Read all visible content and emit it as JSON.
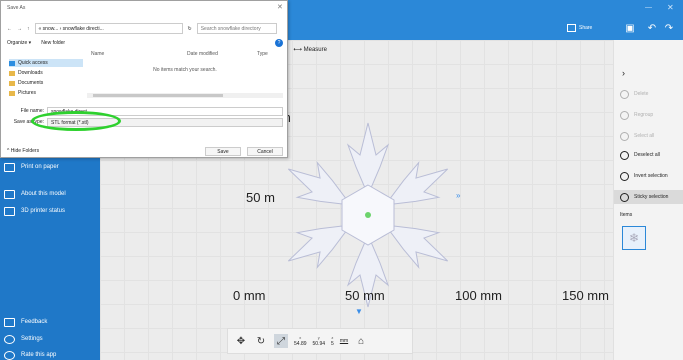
{
  "toolbar": {
    "share_label": "Share",
    "min_glyph": "—",
    "close_glyph": "✕",
    "undo_glyph": "↶",
    "redo_glyph": "↷"
  },
  "sidebar": {
    "items": [
      {
        "label": "Print on paper",
        "icon": "printer-icon"
      },
      {
        "label": "About this model",
        "icon": "info-card-icon"
      },
      {
        "label": "3D printer status",
        "icon": "list-icon"
      }
    ],
    "bottom_items": [
      {
        "label": "Feedback",
        "icon": "feedback-icon"
      },
      {
        "label": "Settings",
        "icon": "gear-icon"
      },
      {
        "label": "Rate this app",
        "icon": "smiley-icon"
      }
    ]
  },
  "viewport": {
    "measure_toolbar": {
      "left_label": "er",
      "measure_label": "Measure"
    },
    "axis_labels": [
      "0 mm",
      "50 mm",
      "100 mm",
      "150 mm"
    ],
    "side_labels": [
      "m",
      "50 m"
    ]
  },
  "bottom_toolbar": {
    "coords": [
      {
        "axis": "x",
        "value": "54.89"
      },
      {
        "axis": "y",
        "value": "50.94"
      },
      {
        "axis": "z",
        "value": "5"
      }
    ],
    "unit": "mm"
  },
  "right_panel": {
    "items": [
      {
        "label": "Delete",
        "disabled": true
      },
      {
        "label": "Regroup",
        "disabled": true
      },
      {
        "label": "Select all",
        "disabled": true
      },
      {
        "label": "Deselect all",
        "disabled": false
      },
      {
        "label": "Invert selection",
        "disabled": false
      },
      {
        "label": "Sticky selection",
        "disabled": false,
        "selected": true
      }
    ],
    "section_label": "Items"
  },
  "dialog": {
    "title": "Save As",
    "close_glyph": "✕",
    "path": "« snow... › snowflake directi...",
    "search_placeholder": "Search snowflake directory",
    "organize_label": "Organize ▾",
    "new_folder_label": "New folder",
    "columns": [
      "Name",
      "Date modified",
      "Type"
    ],
    "empty_text": "No items match your search.",
    "nav_items": [
      {
        "label": "Quick access",
        "selected": true,
        "icon": "star-icon"
      },
      {
        "label": "Downloads",
        "selected": false,
        "icon": "download-folder-icon"
      },
      {
        "label": "Documents",
        "selected": false,
        "icon": "documents-folder-icon"
      },
      {
        "label": "Pictures",
        "selected": false,
        "icon": "pictures-folder-icon"
      }
    ],
    "filename_label": "File name:",
    "filename_value": "snowflake direct...",
    "savetype_label": "Save as type:",
    "savetype_value": "STL format (*.stl)",
    "hide_folders_label": "Hide Folders",
    "save_label": "Save",
    "cancel_label": "Cancel",
    "highlight_color": "#2ed12e"
  },
  "colors": {
    "accent": "#2b88d8",
    "sidebar": "#1f78c8"
  }
}
